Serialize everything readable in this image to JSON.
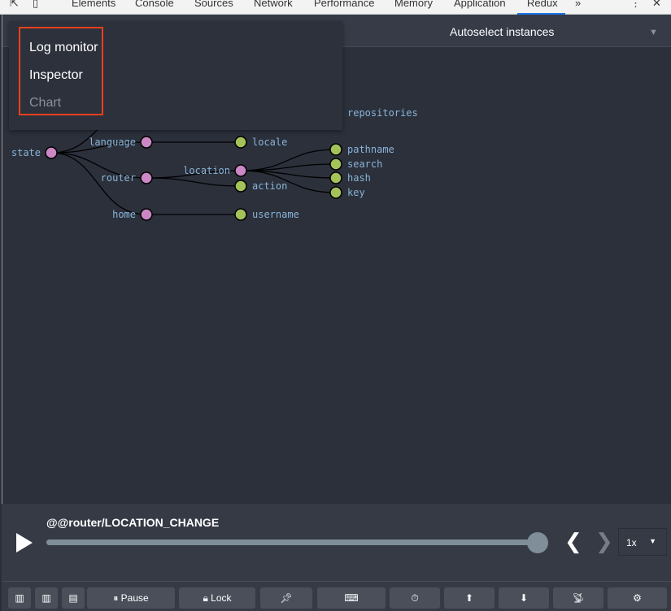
{
  "devtools_tabs": [
    "Elements",
    "Console",
    "Sources",
    "Network",
    "Performance",
    "Memory",
    "Application",
    "Redux"
  ],
  "more_tabs": "»",
  "instance_select": "Autoselect instances",
  "monitor_menu": {
    "items": [
      "Log monitor",
      "Inspector",
      "Chart"
    ]
  },
  "tree": {
    "nodes": [
      "state",
      "language",
      "router",
      "home",
      "locale",
      "location",
      "action",
      "username",
      "pathname",
      "search",
      "hash",
      "key",
      "repositories"
    ]
  },
  "player": {
    "action": "@@router/LOCATION_CHANGE",
    "progress": 1.0,
    "speed": "1x"
  },
  "toolbar": {
    "pause": "Pause",
    "lock": "Lock"
  },
  "colors": {
    "object_node": "#cc88c4",
    "leaf_node": "#a4c25a",
    "highlight": "#e8401c"
  }
}
